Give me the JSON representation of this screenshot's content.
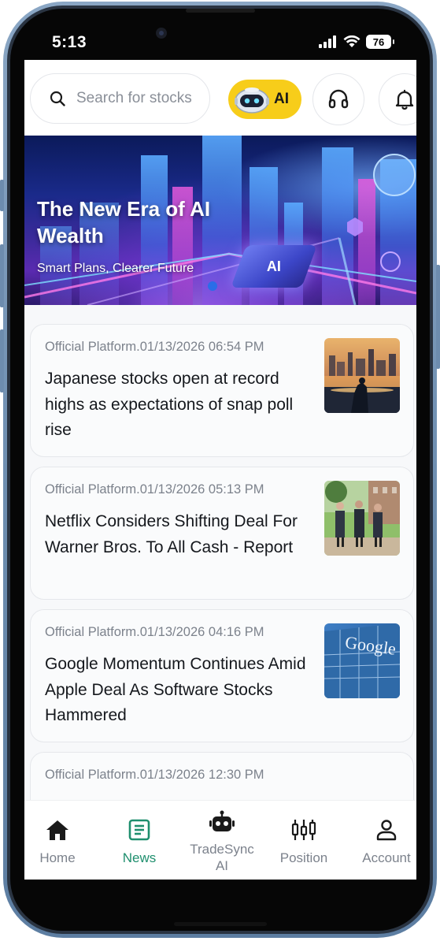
{
  "status_bar": {
    "time": "5:13",
    "battery": "76"
  },
  "header": {
    "search_placeholder": "Search for stocks",
    "ai_label": "AI"
  },
  "banner": {
    "title": "The New Era of AI Wealth",
    "subtitle": "Smart Plans, Clearer Future",
    "chip_label": "AI"
  },
  "news": [
    {
      "meta": "Official Platform.01/13/2026 06:54 PM",
      "headline": "Japanese stocks open at record highs as expectations of snap poll rise"
    },
    {
      "meta": "Official Platform.01/13/2026 05:13 PM",
      "headline": "Netflix Considers Shifting Deal For Warner Bros. To All Cash - Report"
    },
    {
      "meta": "Official Platform.01/13/2026 04:16 PM",
      "headline": "Google Momentum Continues Amid Apple Deal As Software Stocks Hammered",
      "thumb_text": "Google"
    },
    {
      "meta": "Official Platform.01/13/2026 12:30 PM",
      "headline": ""
    }
  ],
  "bottom_nav": [
    {
      "label": "Home",
      "icon": "home-icon",
      "active": false
    },
    {
      "label": "News",
      "icon": "news-icon",
      "active": true
    },
    {
      "label": "TradeSync AI",
      "icon": "robot-icon",
      "active": false
    },
    {
      "label": "Position",
      "icon": "candlestick-icon",
      "active": false
    },
    {
      "label": "Account",
      "icon": "person-icon",
      "active": false
    }
  ],
  "colors": {
    "accent": "#1f8f6e",
    "ai_yellow": "#f7cd1a",
    "frame": "#6f8fb1"
  }
}
